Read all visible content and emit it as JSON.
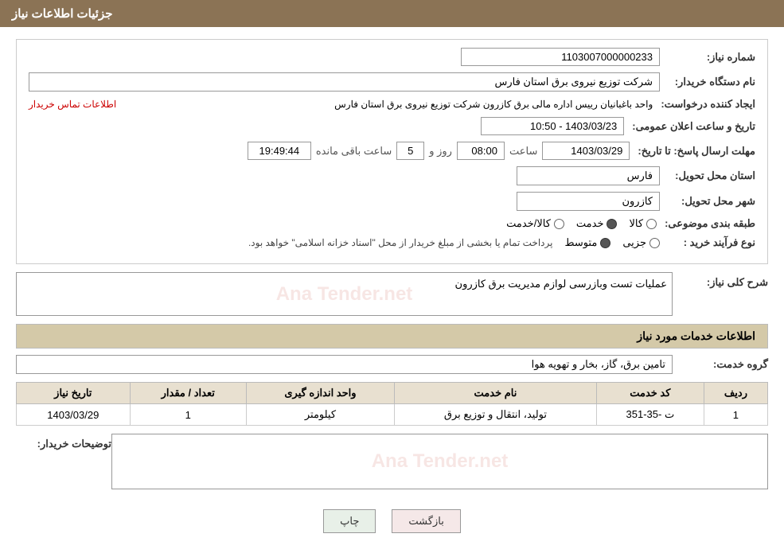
{
  "header": {
    "title": "جزئیات اطلاعات نیاز"
  },
  "fields": {
    "need_number_label": "شماره نیاز:",
    "need_number_value": "1103007000000233",
    "buyer_org_label": "نام دستگاه خریدار:",
    "buyer_org_value": "شرکت توزیع نیروی برق استان فارس",
    "creator_label": "ایجاد کننده درخواست:",
    "creator_value": "واحد باغبانیان رییس اداره مالی برق کازرون شرکت توزیع نیروی برق استان فارس",
    "contact_link_text": "اطلاعات تماس خریدار",
    "announce_date_label": "تاریخ و ساعت اعلان عمومی:",
    "announce_date_value": "1403/03/23 - 10:50",
    "deadline_label": "مهلت ارسال پاسخ: تا تاریخ:",
    "deadline_date": "1403/03/29",
    "deadline_time_label": "ساعت",
    "deadline_time": "08:00",
    "deadline_days_label": "روز و",
    "deadline_days": "5",
    "deadline_remaining_label": "ساعت باقی مانده",
    "deadline_remaining_time": "19:49:44",
    "province_label": "استان محل تحویل:",
    "province_value": "فارس",
    "city_label": "شهر محل تحویل:",
    "city_value": "کازرون",
    "category_label": "طبقه بندی موضوعی:",
    "category_kala": "کالا",
    "category_khadamat": "خدمت",
    "category_kala_khadamat": "کالا/خدمت",
    "category_selected": "khadamat",
    "process_label": "نوع فرآیند خرید :",
    "process_jozi": "جزیی",
    "process_motavaset": "متوسط",
    "process_info": "پرداخت تمام یا بخشی از مبلغ خریدار از محل \"اسناد خزانه اسلامی\" خواهد بود.",
    "description_label": "شرح کلی نیاز:",
    "description_value": "عملیات تست وبازرسی لوازم مدیریت برق کازرون",
    "services_section_title": "اطلاعات خدمات مورد نیاز",
    "service_group_label": "گروه خدمت:",
    "service_group_value": "تامین برق، گاز، بخار و تهویه هوا",
    "table_headers": {
      "row_num": "ردیف",
      "service_code": "کد خدمت",
      "service_name": "نام خدمت",
      "unit": "واحد اندازه گیری",
      "quantity": "تعداد / مقدار",
      "date": "تاریخ نیاز"
    },
    "table_rows": [
      {
        "row_num": "1",
        "service_code": "ت -35-351",
        "service_name": "تولید، انتقال و توزیع برق",
        "unit": "کیلومتر",
        "quantity": "1",
        "date": "1403/03/29"
      }
    ],
    "buyer_notes_label": "توضیحات خریدار:",
    "buyer_notes_value": ""
  },
  "buttons": {
    "print_label": "چاپ",
    "back_label": "بازگشت"
  },
  "watermark_text": "Ana Tender.net"
}
